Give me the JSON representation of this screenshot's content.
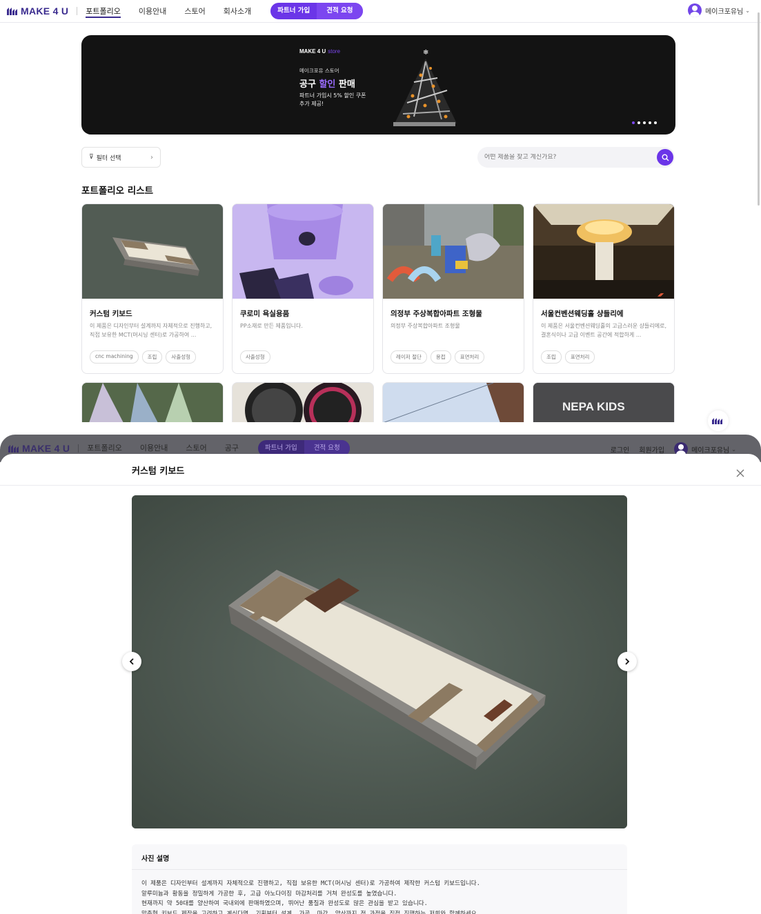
{
  "header": {
    "logo": "MAKE 4 U",
    "nav": [
      "포트폴리오",
      "이용안내",
      "스토어",
      "회사소개"
    ],
    "partner_btn": "파트너 가입",
    "quote_btn": "견적 요청",
    "user_name": "메이크포유님"
  },
  "banner": {
    "logo": "MAKE 4 U",
    "logo_suffix": "store",
    "subtitle": "메이크포유 스토어",
    "title_a": "공구 ",
    "title_b": "할인",
    "title_c": " 판매",
    "desc": "파트너 가입시 5% 할인 쿠폰\n추가 제공!",
    "accent": "#7c46f0"
  },
  "filter": {
    "label": "필터 선택"
  },
  "search": {
    "placeholder": "어떤 제품을 찾고 계신가요?"
  },
  "section_title": "포트폴리오 리스트",
  "cards": [
    {
      "title": "커스텀 키보드",
      "desc": "이 제품은 디자인부터 설계까지 자체적으로 진행하고, 직접 보유한 MCT(머시닝 센터)로 가공하여 ...",
      "tags": [
        "cnc machining",
        "조립",
        "사출성형"
      ]
    },
    {
      "title": "쿠로미 욕실용품",
      "desc": "PP소재로 만든 제품입니다.",
      "tags": [
        "사출성형"
      ]
    },
    {
      "title": "의정부 주상복합아파트 조형물",
      "desc": "의정부 주상복합아파트 조형물",
      "tags": [
        "레이저 절단",
        "용접",
        "표면처리"
      ]
    },
    {
      "title": "서울컨벤션웨딩홀 샹들리에",
      "desc": "이 제품은 서울컨벤션웨딩홀의 고급스러운 샹들리에로, 결혼식이나 고급 이벤트 공간에 적합하게 ...",
      "tags": [
        "조립",
        "표면처리"
      ]
    }
  ],
  "card_row2": {
    "sign_text": "NEPA KIDS"
  },
  "dim_header": {
    "logo": "MAKE 4 U",
    "nav": [
      "포트폴리오",
      "이용안내",
      "스토어",
      "공구"
    ],
    "partner_btn": "파트너 가입",
    "quote_btn": "견적 요청",
    "login": "로그인",
    "signup": "회원가입",
    "user_name": "메이크포유님"
  },
  "modal": {
    "title": "커스텀 키보드",
    "desc_title": "사진 설명",
    "desc_body": "이 제품은 디자인부터 설계까지 자체적으로 진행하고, 직접 보유한 MCT(머시닝 센터)로 가공하여 제작한 커스텀 키보드입니다.\n알루미늄과 황동을 정밀하게 가공한 후, 고급 아노다이징 마감처리를 거쳐 완성도를 높였습니다.\n현재까지 약 50대를 양산하여 국내외에 판매하였으며, 뛰어난 품질과 완성도로 많은 관심을 받고 있습니다.\n맞춤형 키보드 제작을 고려하고 계신다면, 기획부터 설계, 가공, 마감, 양산까지 전 과정을 직접 진행하는 저희와 함께하세요."
  }
}
